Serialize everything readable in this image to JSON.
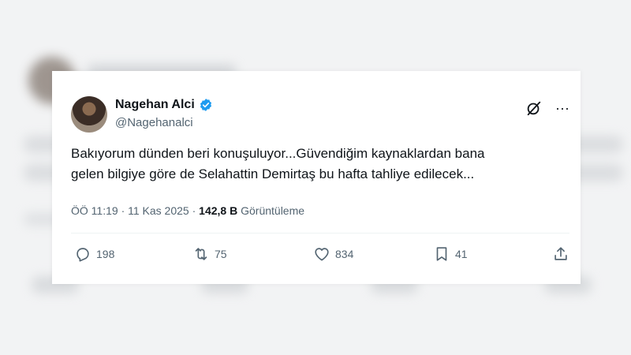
{
  "tweet": {
    "author_name": "Nagehan Alci",
    "handle": "@Nagehanalci",
    "text_line1": "Bakıyorum dünden beri konuşuluyor...Güvendiğim kaynaklardan bana",
    "text_line2": "gelen bilgiye göre de Selahattin Demirtaş bu hafta tahliye edilecek...",
    "time": "ÖÖ 11:19",
    "date": "11 Kas 2025",
    "views_count": "142,8 B",
    "views_label": "Görüntüleme",
    "separator": "·",
    "more_label": "···"
  },
  "actions": {
    "replies": "198",
    "reposts": "75",
    "likes": "834",
    "bookmarks": "41"
  },
  "icons": {
    "verified": "verified-badge-icon",
    "grok": "grok-icon",
    "more": "more-icon",
    "reply": "reply-icon",
    "repost": "repost-icon",
    "like": "heart-icon",
    "bookmark": "bookmark-icon",
    "share": "share-icon"
  },
  "colors": {
    "verified": "#1d9bf0",
    "text": "#0f1419",
    "secondary": "#536471"
  }
}
